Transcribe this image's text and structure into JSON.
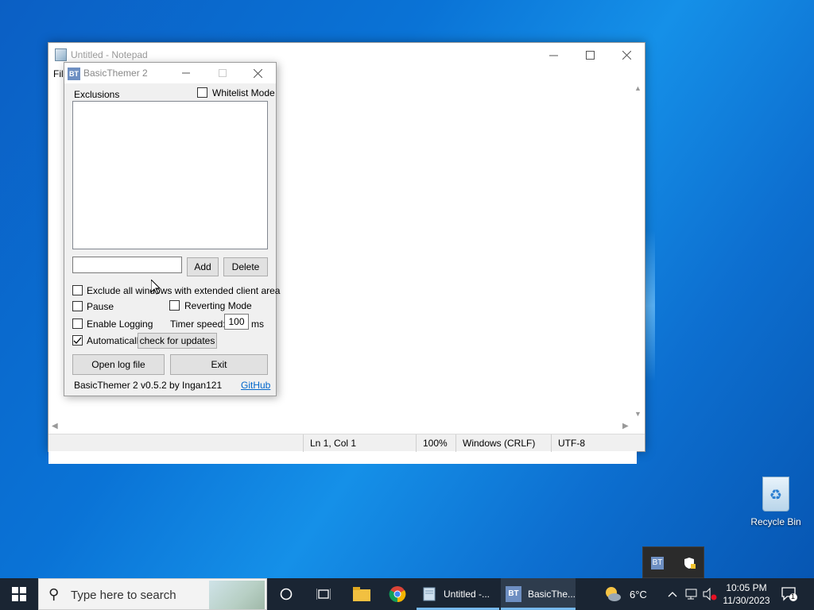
{
  "notepad": {
    "title": "Untitled - Notepad",
    "menu_file": "Fil",
    "status": {
      "position": "Ln 1, Col 1",
      "zoom": "100%",
      "line_ending": "Windows (CRLF)",
      "encoding": "UTF-8"
    }
  },
  "basicthemer": {
    "title": "BasicThemer 2",
    "icon_text": "BT",
    "exclusions_label": "Exclusions",
    "whitelist_label": "Whitelist Mode",
    "whitelist_checked": false,
    "exclusion_input_value": "",
    "add_label": "Add",
    "delete_label": "Delete",
    "exclude_extended_label": "Exclude all windows with extended client area",
    "pause_label": "Pause",
    "reverting_label": "Reverting Mode",
    "enable_logging_label": "Enable Logging",
    "timer_speed_label": "Timer speed:",
    "timer_speed_value": "100",
    "timer_unit": "ms",
    "auto_label": "Automatically",
    "check_updates_label": "check for updates",
    "auto_checked": true,
    "open_log_label": "Open log file",
    "exit_label": "Exit",
    "version_text": "BasicThemer 2 v0.5.2 by Ingan121",
    "github_label": "GitHub"
  },
  "desktop": {
    "recycle_bin_label": "Recycle Bin"
  },
  "taskbar": {
    "search_placeholder": "Type here to search",
    "apps": [
      {
        "label": "Untitled -..."
      },
      {
        "label": "BasicThe..."
      }
    ],
    "weather": "6°C",
    "time": "10:05 PM",
    "date": "11/30/2023",
    "notification_count": "1"
  },
  "icons": {
    "start": "windows-logo-icon",
    "search": "search-icon",
    "cortana": "cortana-circle-icon",
    "task_view": "task-view-icon",
    "explorer": "file-explorer-icon",
    "chrome": "chrome-icon"
  }
}
